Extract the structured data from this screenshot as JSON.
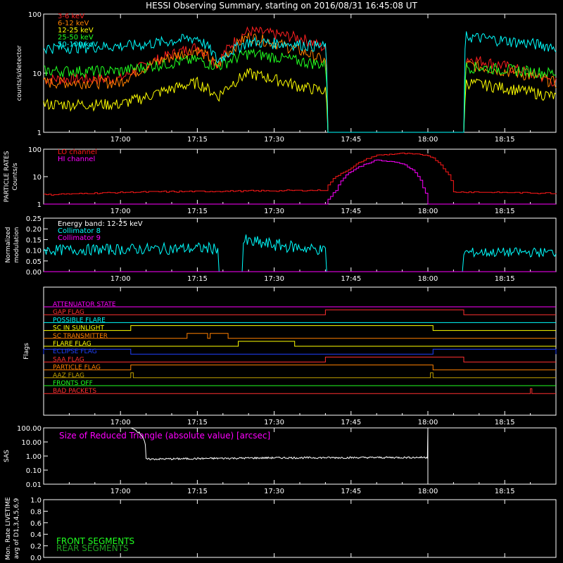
{
  "title": "HESSI Observing Summary, starting on 2016/08/31 16:45:08 UT",
  "colors": {
    "c3_6": "#ff2020",
    "c6_12": "#ff8000",
    "c12_25": "#ffff00",
    "c25_50": "#20ff20",
    "c50_100": "#00ffff",
    "lo": "#ff1818",
    "hi": "#ff00ff",
    "coll8": "#00ffff",
    "coll9": "#ff00ff",
    "sas": "#ffffff"
  },
  "time_ticks": [
    "17:00",
    "17:15",
    "17:30",
    "17:45",
    "18:00",
    "18:15"
  ],
  "panels": {
    "counts": {
      "ylabel": "counts/s/detector",
      "ticks": [
        "100",
        "10",
        "1"
      ]
    },
    "particle": {
      "ylabel1": "PARTICLE RATES",
      "ylabel2": "Counts/s",
      "ticks": [
        "100",
        "10",
        "1"
      ]
    },
    "modulation": {
      "ylabel1": "Normalized",
      "ylabel2": "modulation",
      "ticks": [
        "0.25",
        "0.20",
        "0.15",
        "0.10",
        "0.05",
        "0.00"
      ],
      "energy_band": "Energy band: 12-25 keV"
    },
    "flags": {
      "ylabel": "Flags"
    },
    "sas": {
      "ylabel": "SAS",
      "ticks": [
        "100.00",
        "10.00",
        "1.00",
        "0.10",
        "0.01"
      ],
      "legend": "Size of Reduced Triangle (absolute value) [arcsec]"
    },
    "livetime": {
      "ylabel1": "Mon. Rate LIVETIME",
      "ylabel2": "avg of D1,3,4,5,6,9",
      "ticks": [
        "1.0",
        "0.8",
        "0.6",
        "0.4",
        "0.2",
        "0.0"
      ],
      "front": "FRONT SEGMENTS",
      "rear": "REAR SEGMENTS"
    }
  },
  "chart_data": [
    {
      "type": "line",
      "title": "HESSI Observing Summary, starting on 2016/08/31 16:45:08 UT",
      "ylabel": "counts/s/detector",
      "yscale": "log",
      "ylim": [
        1,
        100
      ],
      "x_range": [
        "16:45",
        "18:25"
      ],
      "series": [
        {
          "name": "3-6 keV",
          "color": "#ff2020",
          "x": [
            "16:45",
            "17:00",
            "17:05",
            "17:15",
            "17:19",
            "17:25",
            "17:35",
            "17:40",
            "17:40.5",
            "18:07",
            "18:07.5",
            "18:25"
          ],
          "values": [
            8,
            8,
            14,
            28,
            14,
            52,
            40,
            26,
            1,
            1,
            18,
            7
          ]
        },
        {
          "name": "6-12 keV",
          "color": "#ff8000",
          "x": [
            "16:45",
            "17:00",
            "17:05",
            "17:15",
            "17:19",
            "17:25",
            "17:35",
            "17:40",
            "17:40.5",
            "18:07",
            "18:07.5",
            "18:25"
          ],
          "values": [
            7,
            7,
            13,
            25,
            13,
            42,
            24,
            16,
            1,
            1,
            14,
            7
          ]
        },
        {
          "name": "12-25 keV",
          "color": "#ffff00",
          "x": [
            "16:45",
            "17:00",
            "17:05",
            "17:15",
            "17:19",
            "17:25",
            "17:35",
            "17:40",
            "17:40.5",
            "18:07",
            "18:07.5",
            "18:25"
          ],
          "values": [
            3,
            3,
            4,
            7,
            4,
            10,
            6,
            5,
            1,
            1,
            7,
            4
          ]
        },
        {
          "name": "25-50 keV",
          "color": "#20ff20",
          "x": [
            "16:45",
            "17:00",
            "17:05",
            "17:15",
            "17:19",
            "17:25",
            "17:35",
            "17:40",
            "17:40.5",
            "18:07",
            "18:07.5",
            "18:25"
          ],
          "values": [
            11,
            11,
            13,
            17,
            13,
            22,
            16,
            14,
            1,
            1,
            13,
            10
          ]
        },
        {
          "name": "50-100 keV",
          "color": "#00ffff",
          "x": [
            "16:45",
            "17:00",
            "17:05",
            "17:15",
            "17:19",
            "17:25",
            "17:35",
            "17:40",
            "17:40.5",
            "18:07",
            "18:07.5",
            "18:25"
          ],
          "values": [
            27,
            29,
            31,
            40,
            16,
            34,
            31,
            28,
            1,
            1,
            42,
            28
          ]
        }
      ]
    },
    {
      "type": "line",
      "ylabel": "PARTICLE RATES Counts/s",
      "yscale": "log",
      "ylim": [
        1,
        100
      ],
      "series": [
        {
          "name": "LO channel",
          "color": "#ff1818",
          "x": [
            "16:45",
            "17:05",
            "17:25",
            "17:40",
            "17:45",
            "17:50",
            "17:55",
            "18:00",
            "18:03",
            "18:05",
            "18:25"
          ],
          "values": [
            2.2,
            2.8,
            3.0,
            3.2,
            20,
            60,
            70,
            60,
            20,
            2.8,
            2.5
          ]
        },
        {
          "name": "HI channel",
          "color": "#ff00ff",
          "x": [
            "16:45",
            "17:40",
            "17:42",
            "17:46",
            "17:50",
            "17:55",
            "17:59",
            "18:00",
            "18:25"
          ],
          "values": [
            1,
            1,
            3,
            20,
            40,
            30,
            4,
            1,
            1
          ]
        }
      ]
    },
    {
      "type": "line",
      "ylabel": "Normalized modulation",
      "ylim": [
        0,
        0.25
      ],
      "annotation": "Energy band: 12-25 keV",
      "series": [
        {
          "name": "Collimator 8",
          "color": "#00ffff",
          "x": [
            "16:45",
            "17:19",
            "17:24",
            "17:40",
            "18:07",
            "18:25"
          ],
          "values": [
            0.1,
            0.11,
            0.14,
            0.1,
            0.09,
            0.09
          ]
        },
        {
          "name": "Collimator 9",
          "color": "#ff00ff",
          "x": [
            "16:45",
            "18:25"
          ],
          "values": [
            0.0,
            0.0
          ]
        }
      ]
    },
    {
      "type": "line",
      "ylabel": "Flags",
      "flags": [
        {
          "name": "ATTENUATOR STATE",
          "color": "#ff00ff",
          "on": []
        },
        {
          "name": "GAP FLAG",
          "color": "#ff3030",
          "on": [
            [
              "17:40",
              "18:07"
            ]
          ]
        },
        {
          "name": "POSSIBLE FLARE",
          "color": "#00ffff",
          "on": []
        },
        {
          "name": "SC IN SUNLIGHT",
          "color": "#ffff00",
          "on": [
            [
              "17:02",
              "18:01"
            ]
          ]
        },
        {
          "name": "SC TRANSMITTER",
          "color": "#ff8000",
          "on": [
            [
              "17:13",
              "17:17"
            ],
            [
              "17:17.5",
              "17:21"
            ]
          ]
        },
        {
          "name": "FLARE FLAG",
          "color": "#ffff00",
          "on": [
            [
              "17:23",
              "17:34"
            ]
          ]
        },
        {
          "name": "ECLIPSE FLAG",
          "color": "#2040ff",
          "on": [
            [
              "16:45",
              "17:02"
            ],
            [
              "18:01",
              "18:25"
            ]
          ]
        },
        {
          "name": "SAA FLAG",
          "color": "#ff3030",
          "on": [
            [
              "17:40",
              "18:07"
            ]
          ]
        },
        {
          "name": "PARTICLE FLAG",
          "color": "#ff8000",
          "on": [
            [
              "17:02",
              "18:01"
            ]
          ]
        },
        {
          "name": "AAZ FLAG",
          "color": "#c0a000",
          "on": [
            [
              "17:02",
              "17:02.5"
            ],
            [
              "18:00.5",
              "18:01"
            ]
          ]
        },
        {
          "name": "FRONTS OFF",
          "color": "#20ff20",
          "on": []
        },
        {
          "name": "BAD PACKETS",
          "color": "#ff3030",
          "on": [
            [
              "18:20",
              "18:20.3"
            ]
          ]
        }
      ]
    },
    {
      "type": "line",
      "ylabel": "SAS",
      "yscale": "log",
      "ylim": [
        0.01,
        100
      ],
      "series": [
        {
          "name": "Size of Reduced Triangle (absolute value) [arcsec]",
          "color": "#ffffff",
          "x": [
            "17:02",
            "17:05",
            "17:30",
            "18:00"
          ],
          "values": [
            100,
            0.6,
            0.75,
            0.8
          ]
        }
      ]
    },
    {
      "type": "line",
      "ylabel": "Mon. Rate LIVETIME avg of D1,3,4,5,6,9",
      "ylim": [
        0,
        1
      ],
      "series": [
        {
          "name": "FRONT SEGMENTS",
          "color": "#20ff20",
          "x": [],
          "values": []
        },
        {
          "name": "REAR SEGMENTS",
          "color": "#20a020",
          "x": [],
          "values": []
        }
      ]
    }
  ]
}
